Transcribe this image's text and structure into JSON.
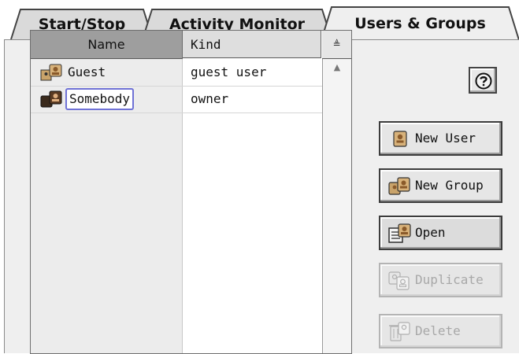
{
  "tabs": [
    {
      "label": "Start/Stop",
      "active": false
    },
    {
      "label": "Activity Monitor",
      "active": false
    },
    {
      "label": "Users & Groups",
      "active": true
    }
  ],
  "list": {
    "columns": [
      {
        "label": "Name",
        "sorted": true
      },
      {
        "label": "Kind",
        "sorted": false
      }
    ],
    "sort_indicator": "≜",
    "rows": [
      {
        "name": "Guest",
        "kind": "guest user",
        "icon": "guest-user-icon",
        "editing": false
      },
      {
        "name": "Somebody",
        "kind": "owner",
        "icon": "owner-user-icon",
        "editing": true
      }
    ]
  },
  "help": {
    "icon": "question-icon"
  },
  "buttons": {
    "new_user": {
      "label": "New User",
      "icon": "new-user-icon",
      "enabled": true
    },
    "new_group": {
      "label": "New Group",
      "icon": "new-group-icon",
      "enabled": true
    },
    "open": {
      "label": "Open",
      "icon": "open-icon",
      "enabled": true
    },
    "duplicate": {
      "label": "Duplicate",
      "icon": "duplicate-icon",
      "enabled": false
    },
    "delete": {
      "label": "Delete",
      "icon": "delete-icon",
      "enabled": false
    }
  },
  "colors": {
    "panel_bg": "#efefef",
    "selected_header": "#9e9e9e",
    "edit_outline": "#6f72d6",
    "disabled_text": "#a8a8a8"
  }
}
